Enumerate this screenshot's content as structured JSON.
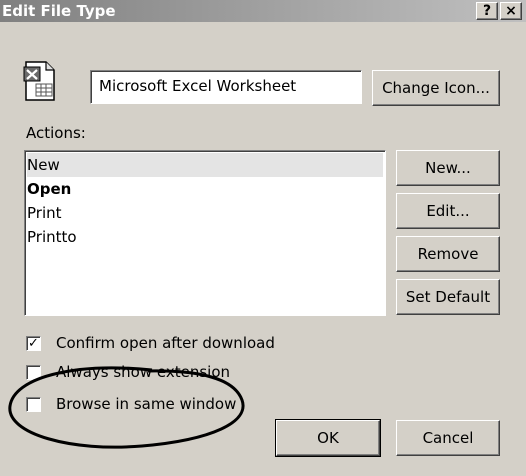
{
  "window": {
    "title": "Edit File Type",
    "help_glyph": "?",
    "close_glyph": "×"
  },
  "file_type": {
    "icon": "excel-file-icon",
    "name": "Microsoft Excel Worksheet",
    "change_icon_label": "Change Icon..."
  },
  "actions": {
    "label": "Actions:",
    "items": [
      {
        "label": "New",
        "selected": true,
        "bold": false
      },
      {
        "label": "Open",
        "selected": false,
        "bold": true
      },
      {
        "label": "Print",
        "selected": false,
        "bold": false
      },
      {
        "label": "Printto",
        "selected": false,
        "bold": false
      }
    ],
    "buttons": {
      "new": "New...",
      "edit": "Edit...",
      "remove": "Remove",
      "set_default": "Set Default"
    }
  },
  "options": {
    "confirm_open": {
      "label": "Confirm open after download",
      "checked": true
    },
    "always_show_extension": {
      "label": "Always show extension",
      "checked": false
    },
    "browse_same_window": {
      "label": "Browse in same window",
      "checked": false
    }
  },
  "footer": {
    "ok": "OK",
    "cancel": "Cancel"
  }
}
